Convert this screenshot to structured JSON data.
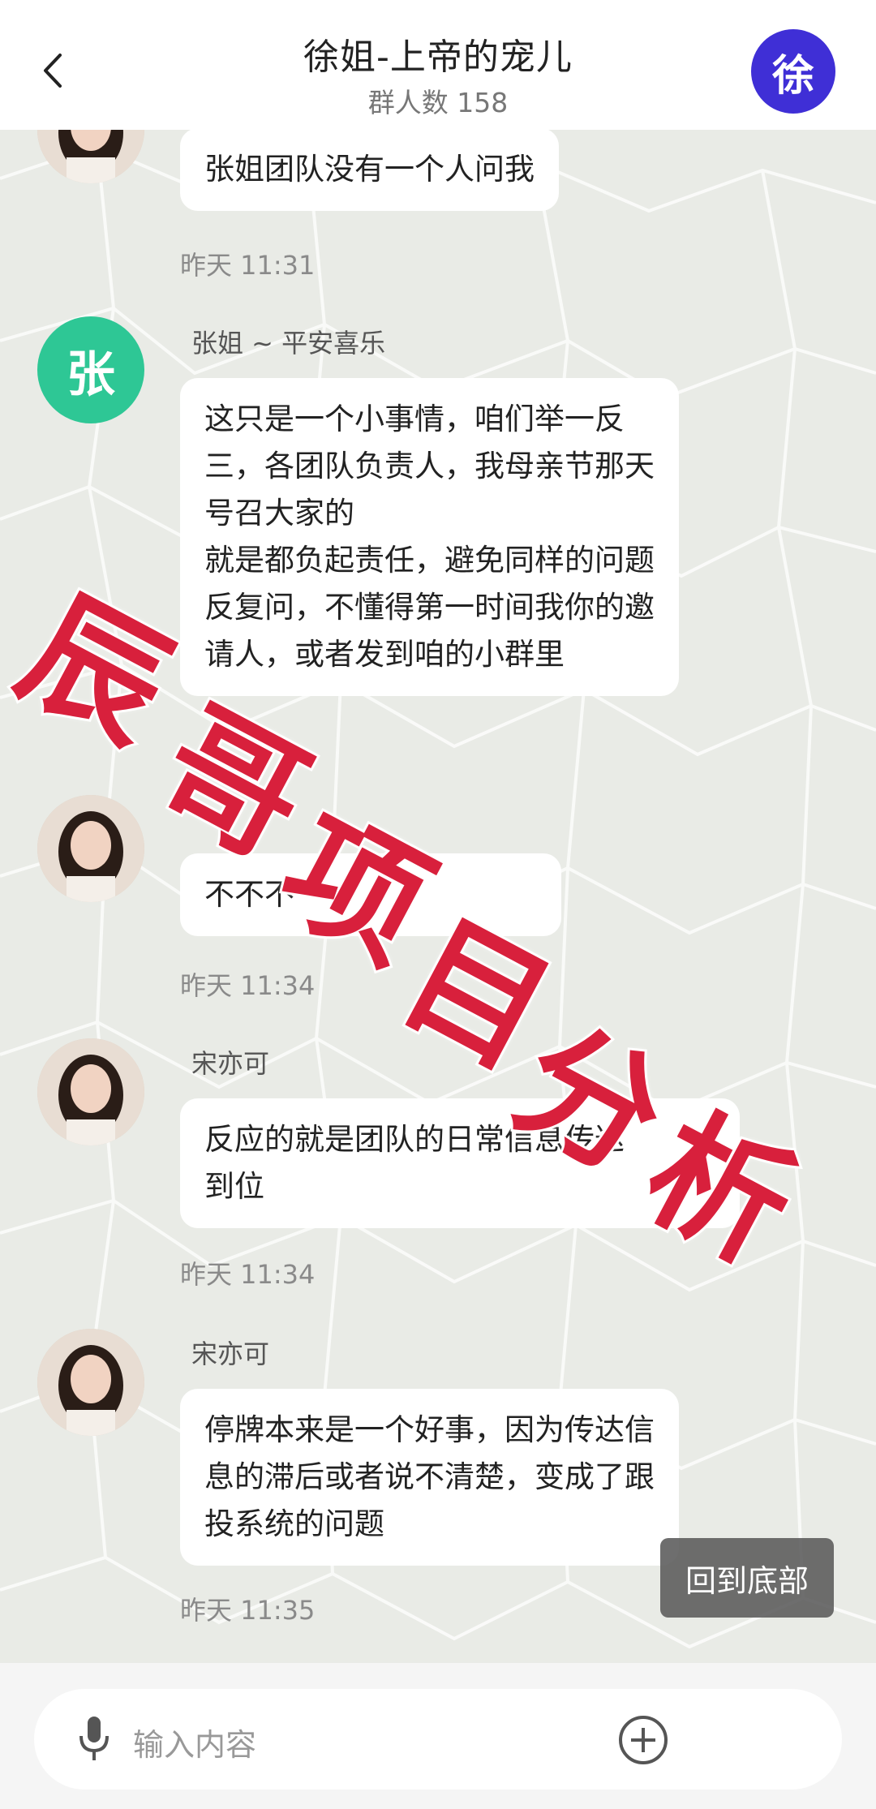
{
  "header": {
    "title": "徐姐-上帝的宠儿",
    "subtitle": "群人数 158",
    "avatar_text": "徐"
  },
  "messages": [
    {
      "sender": "",
      "avatar": "photo",
      "lines": [
        "张姐团队没有一个人问我"
      ],
      "time": "昨天 11:31"
    },
    {
      "sender": "张姐 ~ 平安喜乐",
      "avatar": "letter",
      "avatar_text": "张",
      "lines": [
        "这只是一个小事情，咱们举一反",
        "三，各团队负责人，我母亲节那天",
        "号召大家的",
        "就是都负起责任，避免同样的问题",
        "反复问，不懂得第一时间我你的邀",
        "请人，或者发到咱的小群里"
      ]
    },
    {
      "sender": "",
      "avatar": "photo",
      "lines": [
        "不不不"
      ],
      "time": "昨天 11:34"
    },
    {
      "sender": "宋亦可",
      "avatar": "photo",
      "lines": [
        "反应的就是团队的日常信息传达",
        "到位"
      ],
      "time": "昨天 11:34"
    },
    {
      "sender": "宋亦可",
      "avatar": "photo",
      "lines": [
        "停牌本来是一个好事，因为传达信",
        "息的滞后或者说不清楚，变成了跟",
        "投系统的问题"
      ],
      "time": "昨天 11:35"
    }
  ],
  "back_to_bottom_label": "回到底部",
  "input": {
    "placeholder": "输入内容"
  },
  "watermark": {
    "chars": [
      "辰",
      "哥",
      "项",
      "目",
      "分",
      "析"
    ]
  },
  "colors": {
    "watermark": "#d8203c",
    "letter_avatar": "#2ec795",
    "header_avatar": "#3f2fd6"
  }
}
